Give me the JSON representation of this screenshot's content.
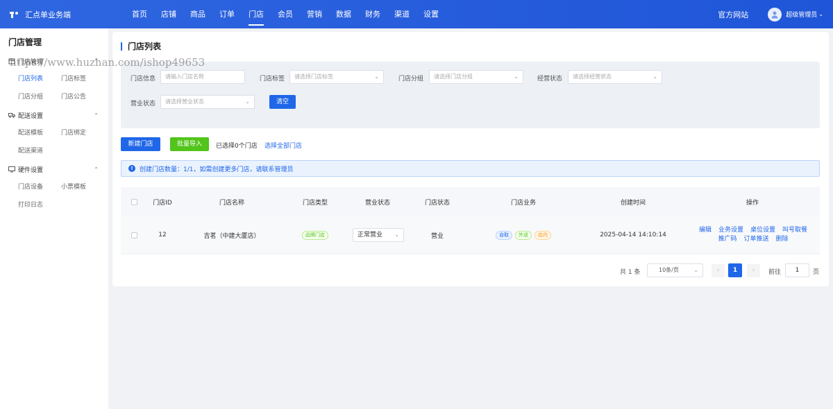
{
  "app": {
    "name": "汇点单业务端",
    "logo_text": "ꟼ"
  },
  "nav": {
    "items": [
      "首页",
      "店铺",
      "商品",
      "订单",
      "门店",
      "会员",
      "营销",
      "数据",
      "财务",
      "渠道",
      "设置"
    ],
    "active": "门店"
  },
  "header_right": {
    "site_link": "官方网站",
    "user_name": "超级管理员"
  },
  "sidebar": {
    "title": "门店管理",
    "groups": [
      {
        "label": "门店管理",
        "items": [
          "门店列表",
          "门店标签",
          "门店分组",
          "门店公告"
        ]
      },
      {
        "label": "配送设置",
        "items": [
          "配送模板",
          "门店绑定",
          "配送渠道"
        ]
      },
      {
        "label": "硬件设置",
        "items": [
          "门店设备",
          "小票模板",
          "打印日志"
        ]
      }
    ],
    "active_item": "门店列表"
  },
  "page": {
    "title": "门店列表"
  },
  "filters": {
    "store_info_label": "门店信息",
    "store_info_placeholder": "请输入门店名称",
    "tag_label": "门店标签",
    "tag_placeholder": "请选择门店标签",
    "group_label": "门店分组",
    "group_placeholder": "请选择门店分组",
    "biz_status_label": "经营状态",
    "biz_status_placeholder": "请选择经营状态",
    "open_status_label": "营业状态",
    "open_status_placeholder": "请选择营业状态",
    "clear_label": "清空"
  },
  "actions": {
    "new_store": "新建门店",
    "bulk_import": "批量导入",
    "selected_text": "已选择0个门店",
    "select_all": "选择全部门店"
  },
  "notice": {
    "text": "创建门店数量：1/1，如需创建更多门店，请联系管理员"
  },
  "table": {
    "headers": [
      "门店ID",
      "门店名称",
      "门店类型",
      "营业状态",
      "门店状态",
      "门店业务",
      "创建时间",
      "操作"
    ],
    "rows": [
      {
        "id": "12",
        "name": "吉茗（中建大厦店）",
        "type": "品牌门店",
        "open_status": "正常营业",
        "store_status": "营业",
        "business": [
          "自取",
          "外送",
          "店内"
        ],
        "created_at": "2025-04-14 14:10:14",
        "ops_line1": [
          "编辑",
          "业务设置",
          "桌位设置",
          "叫号取餐"
        ],
        "ops_line2": [
          "推广码",
          "订单推送",
          "删除"
        ]
      }
    ]
  },
  "pagination": {
    "total_text": "共 1 条",
    "page_size": "10条/页",
    "current_page": "1",
    "goto_label": "前往",
    "goto_value": "1",
    "page_suffix": "页"
  },
  "watermark": "https://www.huzhan.com/ishop49653",
  "colors": {
    "primary": "#1f67e8",
    "success": "#52c41a",
    "header_bg": "#2f66e0"
  }
}
